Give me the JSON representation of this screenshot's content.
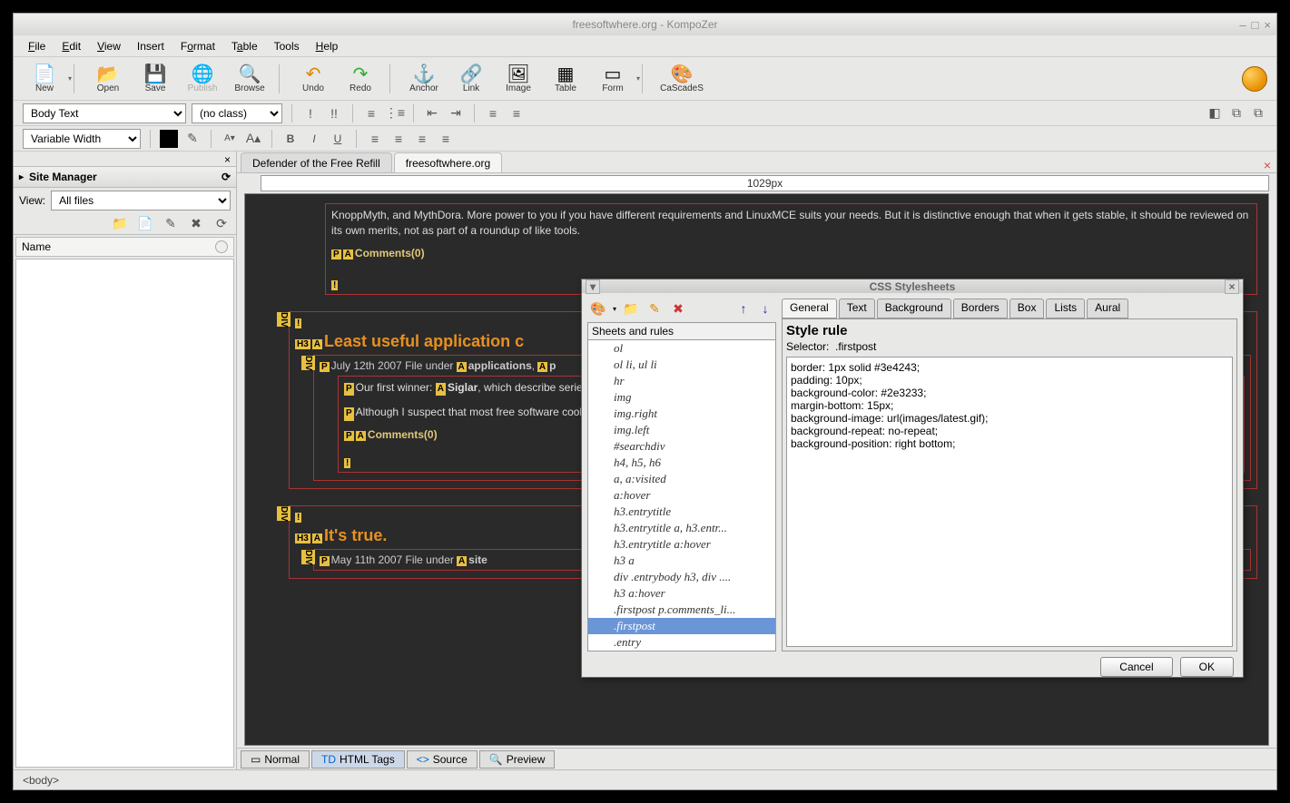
{
  "window": {
    "title": "freesoftwhere.org - KompoZer"
  },
  "menu": {
    "file": "File",
    "edit": "Edit",
    "view": "View",
    "insert": "Insert",
    "format": "Format",
    "table": "Table",
    "tools": "Tools",
    "help": "Help"
  },
  "tb": {
    "new": "New",
    "open": "Open",
    "save": "Save",
    "publish": "Publish",
    "browse": "Browse",
    "undo": "Undo",
    "redo": "Redo",
    "anchor": "Anchor",
    "link": "Link",
    "image": "Image",
    "table": "Table",
    "form": "Form",
    "cascades": "CaScadeS"
  },
  "combo": {
    "para": "Body Text",
    "class": "(no class)",
    "font": "Variable Width"
  },
  "side": {
    "title": "Site Manager",
    "viewlbl": "View:",
    "viewval": "All files",
    "namecol": "Name"
  },
  "tabs": {
    "t1": "Defender of the Free Refill",
    "t2": "freesoftwhere.org"
  },
  "ruler": "1029px",
  "content": {
    "p1": "KnoppMyth, and MythDora.  More power to you if you have different requirements and LinuxMCE suits your needs.  But it is distinctive enough that when it gets stable, it should be reviewed on its own merits, not as part of a roundup of like tools.",
    "comments": "Comments(0)",
    "h3a": "Least useful application c",
    "date1a": "July 12th 2007 File under",
    "date1b": "applications",
    "p2a": "Our first winner: ",
    "p2b": "Siglar",
    "p2c": ", which describe series of words, and it generates an acrony",
    "p3": "Although I suspect that most free software cool acronym, then bend words around to t",
    "h3b": "It's true.",
    "date2a": "May 11th 2007 File under",
    "date2b": "site"
  },
  "viewtabs": {
    "normal": "Normal",
    "htmltags": "HTML Tags",
    "source": "Source",
    "preview": "Preview"
  },
  "status": "<body>",
  "css": {
    "title": "CSS Stylesheets",
    "sheetsrules": "Sheets and rules",
    "tabs": {
      "general": "General",
      "text": "Text",
      "background": "Background",
      "borders": "Borders",
      "box": "Box",
      "lists": "Lists",
      "aural": "Aural"
    },
    "rules": [
      "ol",
      "ol li, ul li",
      "hr",
      "img",
      "img.right",
      "img.left",
      "#searchdiv",
      "h4, h5, h6",
      "a, a:visited",
      "a:hover",
      "h3.entrytitle",
      "h3.entrytitle a, h3.entr...",
      "h3.entrytitle a:hover",
      "h3 a",
      "div .entrybody h3, div ....",
      "h3 a:hover",
      ".firstpost p.comments_li...",
      ".firstpost",
      ".entry"
    ],
    "selected": 17,
    "panetitle": "Style rule",
    "selectorlbl": "Selector:",
    "selectorval": ".firstpost",
    "ruletext": "border: 1px solid #3e4243;\npadding: 10px;\nbackground-color: #2e3233;\nmargin-bottom: 15px;\nbackground-image: url(images/latest.gif);\nbackground-repeat: no-repeat;\nbackground-position: right bottom;",
    "cancel": "Cancel",
    "ok": "OK"
  }
}
